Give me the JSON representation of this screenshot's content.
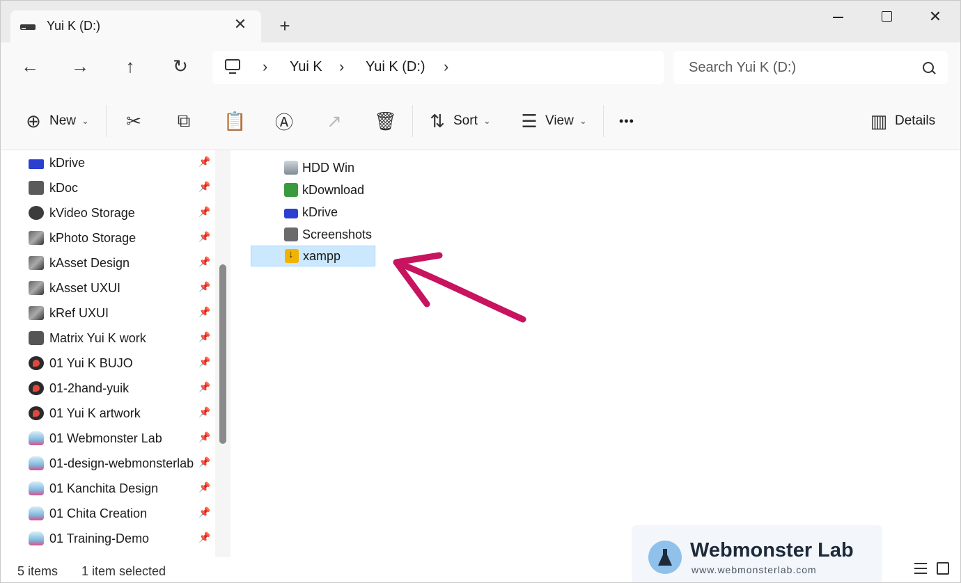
{
  "tab": {
    "title": "Yui K (D:)",
    "close_glyph": "✕"
  },
  "new_tab_glyph": "+",
  "window_controls": {
    "close_glyph": "✕"
  },
  "nav": {
    "back": "←",
    "forward": "→",
    "up": "↑",
    "refresh": "↻"
  },
  "breadcrumb": [
    {
      "label": "Yui K"
    },
    {
      "label": "Yui K (D:)"
    }
  ],
  "breadcrumb_sep": "›",
  "search": {
    "placeholder": "Search Yui K (D:)"
  },
  "toolbar": {
    "new_label": "New",
    "sort_label": "Sort",
    "view_label": "View",
    "more_label": "•••",
    "details_label": "Details",
    "caret": "⌄",
    "new_icon": "⊕",
    "cut_icon": "✂",
    "copy_icon": "⧉",
    "paste_icon": "📋",
    "rename_icon": "Ⓐ",
    "share_icon": "↗",
    "delete_icon": "🗑",
    "sort_icon": "⇅",
    "view_icon": "☰",
    "details_icon": "▥"
  },
  "sidebar": {
    "pin_glyph": "📌",
    "items": [
      {
        "label": "kDrive",
        "icon": "drive-icon"
      },
      {
        "label": "kDoc",
        "icon": "folder-icon"
      },
      {
        "label": "kVideo Storage",
        "icon": "video-folder-icon"
      },
      {
        "label": "kPhoto Storage",
        "icon": "photo-folder-icon"
      },
      {
        "label": "kAsset Design",
        "icon": "asset-folder-icon"
      },
      {
        "label": "kAsset UXUI",
        "icon": "asset-folder-icon"
      },
      {
        "label": "kRef UXUI",
        "icon": "asset-folder-icon"
      },
      {
        "label": "Matrix Yui K work",
        "icon": "matrix-folder-icon"
      },
      {
        "label": "01 Yui K BUJO",
        "icon": "rocket-folder-icon"
      },
      {
        "label": "01-2hand-yuik",
        "icon": "rocket-folder-icon"
      },
      {
        "label": "01 Yui K artwork",
        "icon": "rocket-folder-icon"
      },
      {
        "label": "01 Webmonster Lab",
        "icon": "flask-folder-icon"
      },
      {
        "label": "01-design-webmonsterlab",
        "icon": "flask-folder-icon"
      },
      {
        "label": "01 Kanchita Design",
        "icon": "flask-folder-icon"
      },
      {
        "label": "01 Chita Creation",
        "icon": "flask-folder-icon"
      },
      {
        "label": "01 Training-Demo",
        "icon": "flask-folder-icon"
      }
    ]
  },
  "files": [
    {
      "label": "HDD Win",
      "icon": "hdd-icon",
      "selected": false
    },
    {
      "label": "kDownload",
      "icon": "download-folder-icon",
      "selected": false
    },
    {
      "label": "kDrive",
      "icon": "drive-icon",
      "selected": false
    },
    {
      "label": "Screenshots",
      "icon": "screenshots-folder-icon",
      "selected": false
    },
    {
      "label": "xampp",
      "icon": "xampp-folder-icon",
      "selected": true
    }
  ],
  "annotation": {
    "arrow_color": "#c8135f"
  },
  "status": {
    "count": "5 items",
    "selection": "1 item selected"
  },
  "watermark": {
    "title": "Webmonster Lab",
    "url": "www.webmonsterlab.com"
  },
  "colors": {
    "selection_bg": "#cce8ff",
    "selection_border": "#99d1ff",
    "accent_arrow": "#c8135f"
  }
}
